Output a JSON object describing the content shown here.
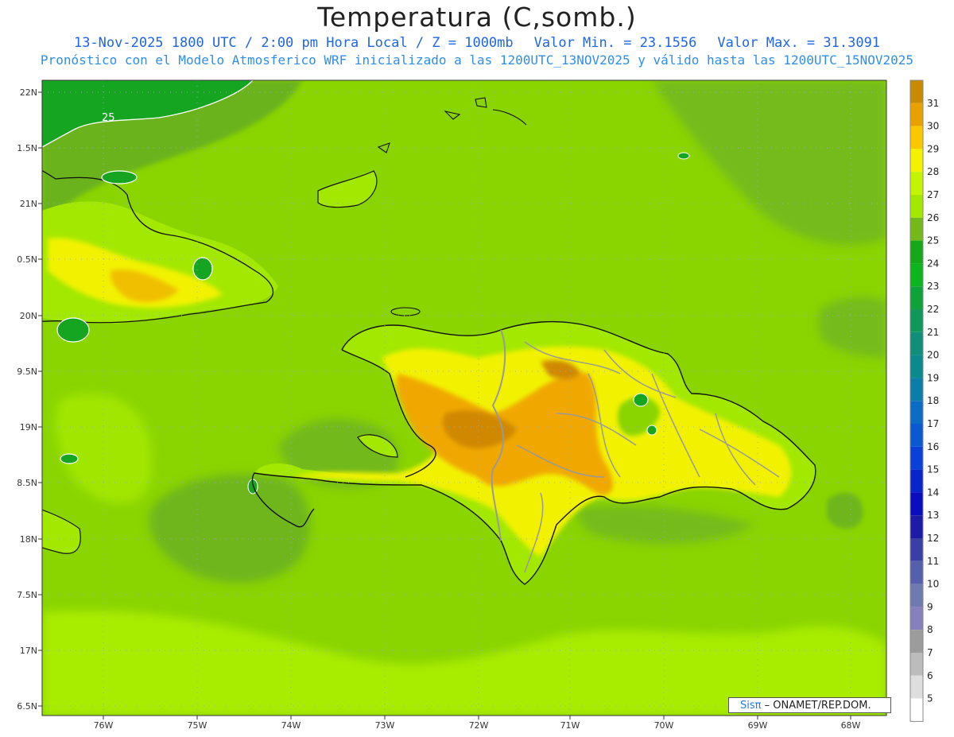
{
  "header": {
    "title": "Temperatura (C,somb.)",
    "line1_main": "13-Nov-2025  1800 UTC / 2:00 pm Hora Local / Z = 1000mb",
    "line1_min": "Valor Min. = 23.1556",
    "line1_max": "Valor Max. = 31.3091",
    "line2": "Pronóstico con el Modelo Atmosferico WRF inicializado a las 1200UTC_13NOV2025 y válido hasta las  1200UTC_15NOV2025"
  },
  "map": {
    "lat_labels": [
      "22N",
      "1.5N",
      "21N",
      "0.5N",
      "20N",
      "9.5N",
      "19N",
      "8.5N",
      "18N",
      "7.5N",
      "17N",
      "6.5N"
    ],
    "lon_labels": [
      "76W",
      "75W",
      "74W",
      "73W",
      "72W",
      "71W",
      "70W",
      "69W",
      "68W"
    ],
    "contour_label": "25",
    "colors": {
      "sea_base": "#8ad400",
      "warm_sea": "#a8ec00",
      "cool_sea": "#6ab31c",
      "cold_patch": "#15a520",
      "land_yellow": "#f2f200",
      "land_orange": "#f0a800",
      "land_brown": "#d08800",
      "coast": "#111111",
      "border": "#999999"
    }
  },
  "colorbar": {
    "labels": [
      "31",
      "30",
      "29",
      "28",
      "27",
      "26",
      "25",
      "24",
      "23",
      "22",
      "21",
      "20",
      "19",
      "18",
      "17",
      "16",
      "15",
      "14",
      "13",
      "12",
      "11",
      "10",
      "9",
      "8",
      "7",
      "6",
      "5"
    ],
    "colors": [
      "#c98a00",
      "#e8a200",
      "#fbc800",
      "#f3f300",
      "#c3f500",
      "#a3e800",
      "#74b91a",
      "#16a81a",
      "#0cb41e",
      "#0ea23a",
      "#10985c",
      "#0f8e7a",
      "#0b8a8e",
      "#0a7ea8",
      "#0a6cc2",
      "#0a58d2",
      "#0a40d8",
      "#0a24cc",
      "#0a0cbd",
      "#1c1ba8",
      "#3a3fa6",
      "#5460ac",
      "#6f7aae",
      "#8880bc",
      "#9c9c9c",
      "#bcbcbc",
      "#dedede",
      "#ffffff"
    ]
  },
  "credit": {
    "sis": "Sisπ",
    "rest": " – ONAMET/REP.DOM."
  }
}
